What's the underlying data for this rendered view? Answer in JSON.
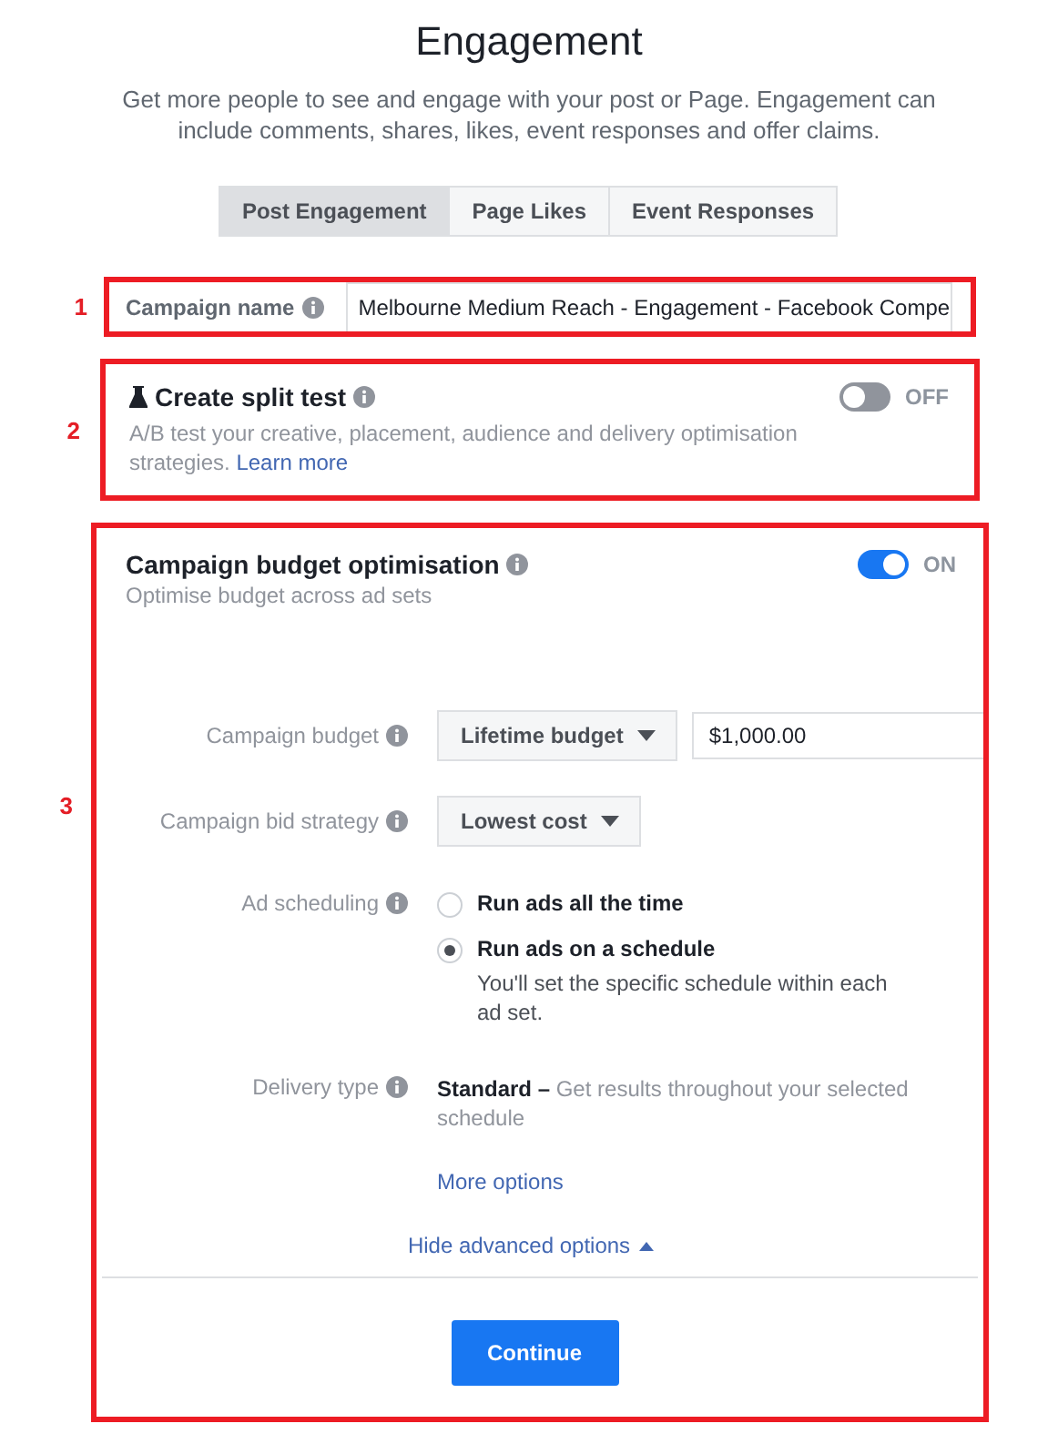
{
  "title": "Engagement",
  "description": "Get more people to see and engage with your post or Page. Engagement can include comments, shares, likes, event responses and offer claims.",
  "tabs": [
    {
      "label": "Post Engagement",
      "selected": true
    },
    {
      "label": "Page Likes",
      "selected": false
    },
    {
      "label": "Event Responses",
      "selected": false
    }
  ],
  "campaign_name": {
    "marker": "1",
    "label": "Campaign name",
    "value": "Melbourne Medium Reach - Engagement - Facebook Compe"
  },
  "split_test": {
    "marker": "2",
    "title": "Create split test",
    "description": "A/B test your creative, placement, audience and delivery optimisation strategies.",
    "link": "Learn more",
    "on": false,
    "toggle_label": "OFF"
  },
  "budget_optimisation": {
    "marker": "3",
    "title": "Campaign budget optimisation",
    "subtitle": "Optimise budget across ad sets",
    "on": true,
    "toggle_label": "ON",
    "budget": {
      "label": "Campaign budget",
      "dropdown": "Lifetime budget",
      "amount": "$1,000.00"
    },
    "bid_strategy": {
      "label": "Campaign bid strategy",
      "dropdown": "Lowest cost"
    },
    "ad_scheduling": {
      "label": "Ad scheduling",
      "options": [
        {
          "label": "Run ads all the time",
          "selected": false
        },
        {
          "label": "Run ads on a schedule",
          "selected": true,
          "note": "You'll set the specific schedule within each ad set."
        }
      ]
    },
    "delivery_type": {
      "label": "Delivery type",
      "value": "**Standard –** Get results throughout your selected schedule",
      "link": "More options"
    },
    "advanced_link": "Hide advanced options",
    "continue_button": "Continue"
  }
}
